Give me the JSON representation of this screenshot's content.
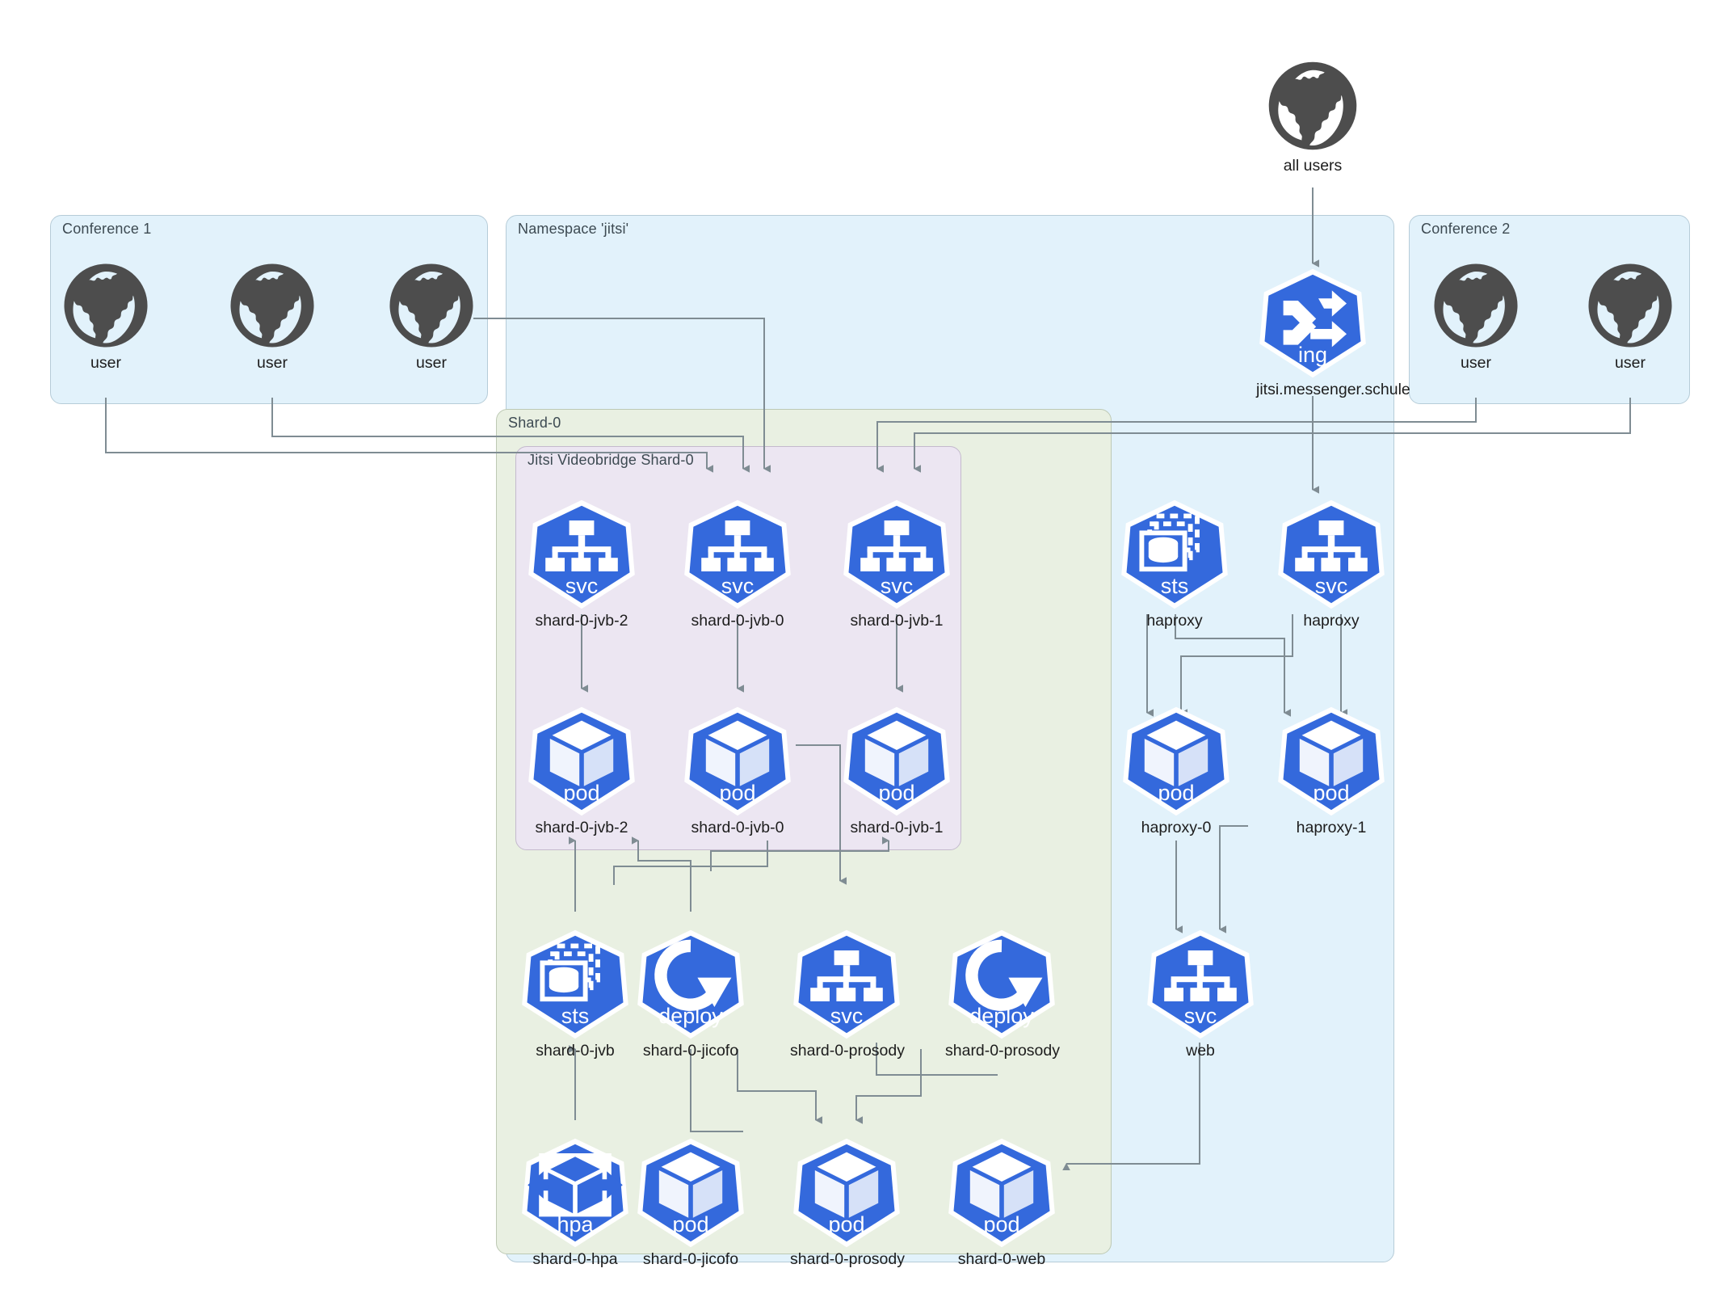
{
  "diagram": {
    "title": "Jitsi Kubernetes Shard Architecture",
    "colors": {
      "k8s_blue": "#3469DC",
      "group_blue": "#e2f2fb",
      "group_green": "#e9f0e2",
      "group_purple": "#ece6f2",
      "edge_gray": "#7f8c93",
      "globe_gray": "#4d4d4d"
    }
  },
  "groups": {
    "conference1": {
      "label": "Conference 1"
    },
    "namespace": {
      "label": "Namespace 'jitsi'"
    },
    "conference2": {
      "label": "Conference 2"
    },
    "shard0": {
      "label": "Shard-0"
    },
    "videobridge": {
      "label": "Jitsi Videobridge Shard-0"
    }
  },
  "internet": {
    "all_users": {
      "icon": "globe-icon",
      "label": "all users"
    }
  },
  "conference1_users": [
    {
      "icon": "globe-icon",
      "label": "user"
    },
    {
      "icon": "globe-icon",
      "label": "user"
    },
    {
      "icon": "globe-icon",
      "label": "user"
    }
  ],
  "conference2_users": [
    {
      "icon": "globe-icon",
      "label": "user"
    },
    {
      "icon": "globe-icon",
      "label": "user"
    }
  ],
  "ingress": {
    "kind": "ing",
    "icon": "ingress-icon",
    "label": "jitsi.messenger.schule"
  },
  "jvb_services": [
    {
      "kind": "svc",
      "icon": "service-icon",
      "label": "shard-0-jvb-2"
    },
    {
      "kind": "svc",
      "icon": "service-icon",
      "label": "shard-0-jvb-0"
    },
    {
      "kind": "svc",
      "icon": "service-icon",
      "label": "shard-0-jvb-1"
    }
  ],
  "jvb_pods": [
    {
      "kind": "pod",
      "icon": "pod-icon",
      "label": "shard-0-jvb-2"
    },
    {
      "kind": "pod",
      "icon": "pod-icon",
      "label": "shard-0-jvb-0"
    },
    {
      "kind": "pod",
      "icon": "pod-icon",
      "label": "shard-0-jvb-1"
    }
  ],
  "shard_controllers": [
    {
      "kind": "sts",
      "icon": "statefulset-icon",
      "label": "shard-0-jvb"
    },
    {
      "kind": "deploy",
      "icon": "deployment-icon",
      "label": "shard-0-jicofo"
    },
    {
      "kind": "svc",
      "icon": "service-icon",
      "label": "shard-0-prosody"
    },
    {
      "kind": "deploy",
      "icon": "deployment-icon",
      "label": "shard-0-prosody"
    }
  ],
  "shard_pods": [
    {
      "kind": "hpa",
      "icon": "hpa-icon",
      "label": "shard-0-hpa"
    },
    {
      "kind": "pod",
      "icon": "pod-icon",
      "label": "shard-0-jicofo"
    },
    {
      "kind": "pod",
      "icon": "pod-icon",
      "label": "shard-0-prosody"
    },
    {
      "kind": "pod",
      "icon": "pod-icon",
      "label": "shard-0-web"
    }
  ],
  "haproxy_controllers": [
    {
      "kind": "sts",
      "icon": "statefulset-icon",
      "label": "haproxy"
    },
    {
      "kind": "svc",
      "icon": "service-icon",
      "label": "haproxy"
    }
  ],
  "haproxy_pods": [
    {
      "kind": "pod",
      "icon": "pod-icon",
      "label": "haproxy-0"
    },
    {
      "kind": "pod",
      "icon": "pod-icon",
      "label": "haproxy-1"
    }
  ],
  "web_service": {
    "kind": "svc",
    "icon": "service-icon",
    "label": "web"
  }
}
